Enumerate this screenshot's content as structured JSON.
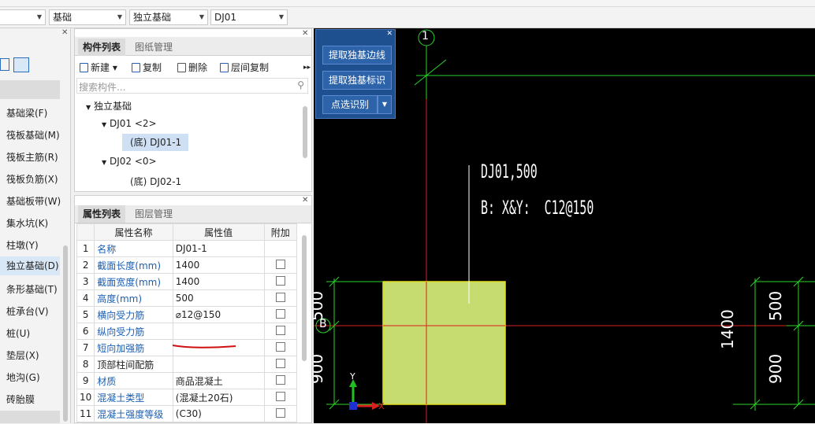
{
  "selectors": [
    {
      "value": ""
    },
    {
      "value": "基础"
    },
    {
      "value": "独立基础"
    },
    {
      "value": "DJ01"
    }
  ],
  "leftnav": {
    "items": [
      {
        "label": "基础梁(F)"
      },
      {
        "label": "筏板基础(M)"
      },
      {
        "label": "筏板主筋(R)"
      },
      {
        "label": "筏板负筋(X)"
      },
      {
        "label": "基础板带(W)"
      },
      {
        "label": "集水坑(K)"
      },
      {
        "label": "柱墩(Y)"
      },
      {
        "label": "独立基础(D)"
      },
      {
        "label": "条形基础(T)"
      },
      {
        "label": "桩承台(V)"
      },
      {
        "label": "桩(U)"
      },
      {
        "label": "垫层(X)"
      },
      {
        "label": "地沟(G)"
      },
      {
        "label": "砖胎膜"
      }
    ]
  },
  "component_panel": {
    "tabs": [
      {
        "label": "构件列表"
      },
      {
        "label": "图纸管理"
      }
    ],
    "toolbar": {
      "new": "新建",
      "copy": "复制",
      "delete": "删除",
      "floor_copy": "层间复制"
    },
    "search_placeholder": "搜索构件...",
    "tree": {
      "root": "独立基础",
      "dj01": "DJ01 <2>",
      "dj01_child": "(底) DJ01-1",
      "dj02": "DJ02 <0>",
      "dj02_child": "(底) DJ02-1"
    }
  },
  "property_panel": {
    "tabs": [
      {
        "label": "属性列表"
      },
      {
        "label": "图层管理"
      }
    ],
    "headers": {
      "name": "属性名称",
      "value": "属性值",
      "extra": "附加"
    },
    "rows": [
      {
        "no": "1",
        "name": "名称",
        "value": "DJ01-1",
        "blue": true,
        "checkbox": false
      },
      {
        "no": "2",
        "name": "截面长度(mm)",
        "value": "1400",
        "blue": true,
        "checkbox": true
      },
      {
        "no": "3",
        "name": "截面宽度(mm)",
        "value": "1400",
        "blue": true,
        "checkbox": true
      },
      {
        "no": "4",
        "name": "高度(mm)",
        "value": "500",
        "blue": true,
        "checkbox": true
      },
      {
        "no": "5",
        "name": "横向受力筋",
        "value": "⌀12@150",
        "blue": true,
        "checkbox": true
      },
      {
        "no": "6",
        "name": "纵向受力筋",
        "value": "",
        "blue": true,
        "checkbox": true
      },
      {
        "no": "7",
        "name": "短向加强筋",
        "value": "",
        "blue": true,
        "checkbox": true
      },
      {
        "no": "8",
        "name": "顶部柱间配筋",
        "value": "",
        "blue": false,
        "checkbox": true
      },
      {
        "no": "9",
        "name": "材质",
        "value": "商品混凝土",
        "blue": true,
        "checkbox": true
      },
      {
        "no": "10",
        "name": "混凝土类型",
        "value": "(混凝土20石)",
        "blue": true,
        "checkbox": true
      },
      {
        "no": "11",
        "name": "混凝土强度等级",
        "value": "(C30)",
        "blue": true,
        "checkbox": true
      }
    ]
  },
  "float_panel": {
    "btn1": "提取独基边线",
    "btn2": "提取独基标识",
    "btn3": "点选识别"
  },
  "canvas": {
    "axis_top": "1",
    "axis_left": "B",
    "label_line1": "DJ01,500",
    "label_line2": "B: X&Y:  C12@150",
    "dim_1400": "1400",
    "dim_500": "500",
    "dim_900": "900",
    "dim_left_top": "500",
    "dim_left_bottom": "900",
    "axis_y": "Y",
    "axis_x": "X"
  }
}
